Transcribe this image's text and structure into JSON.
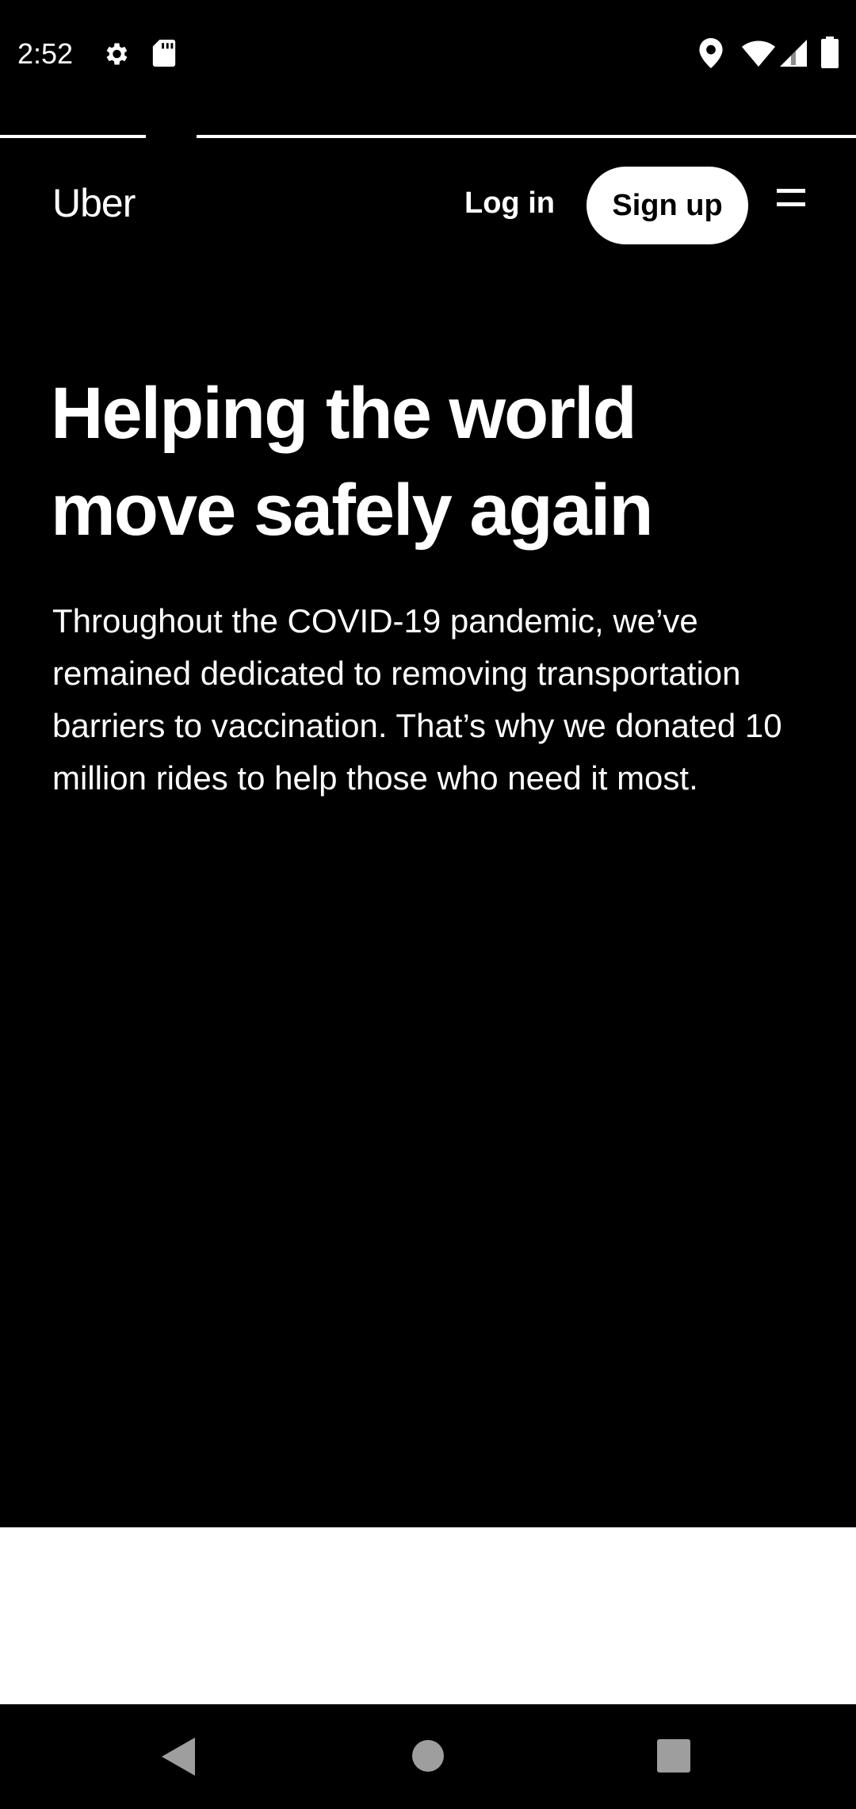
{
  "status_bar": {
    "time": "2:52",
    "icons": [
      "gear-icon",
      "sd-card-icon",
      "location-icon",
      "wifi-icon",
      "signal-icon",
      "battery-icon"
    ]
  },
  "header": {
    "logo_text": "Uber",
    "login_label": "Log in",
    "signup_label": "Sign up",
    "menu_icon": "hamburger-menu-icon"
  },
  "hero": {
    "headline": "Helping the world move safely again",
    "body": "Throughout the COVID-19 pandemic, we’ve remained dedicated to removing transportation barriers to vaccination. That’s why we donated 10 million rides to help those who need it most."
  },
  "navigation_bar": {
    "icons": [
      "back-icon",
      "home-icon",
      "recents-icon"
    ]
  },
  "colors": {
    "background": "#000000",
    "text": "#ffffff",
    "button_bg": "#ffffff",
    "button_text": "#000000",
    "nav_key": "#9e9e9e"
  }
}
